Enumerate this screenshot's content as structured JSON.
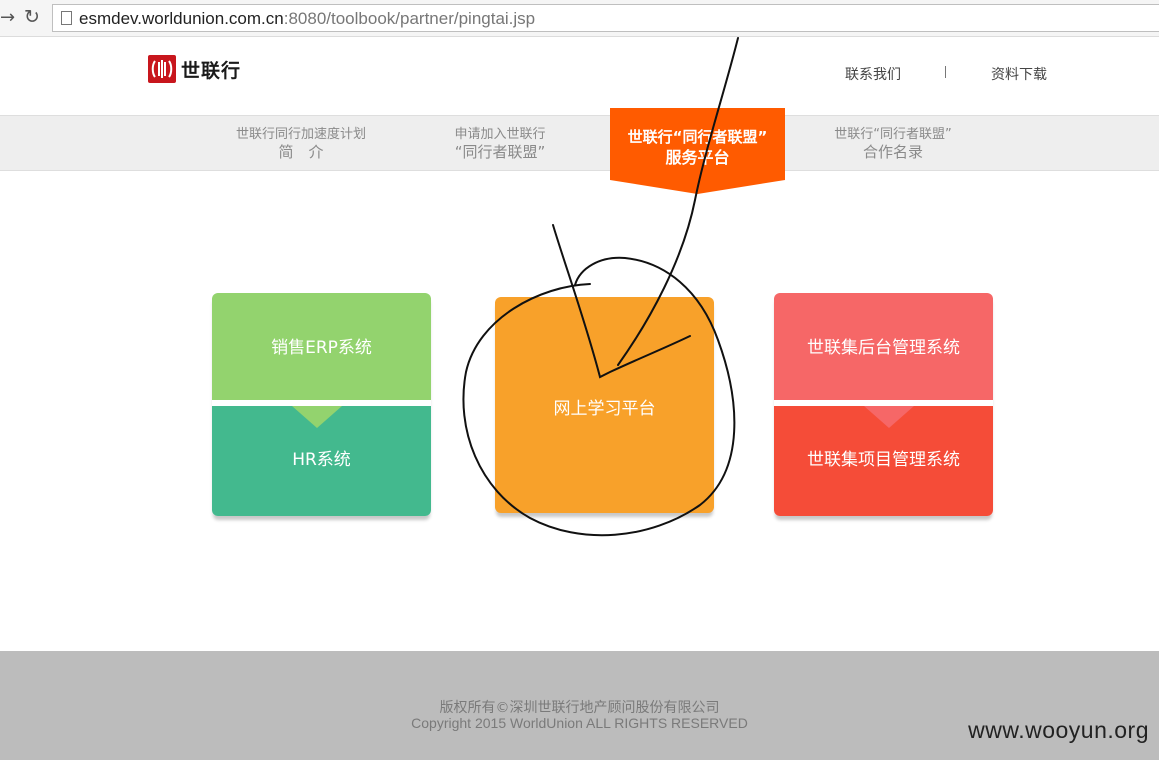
{
  "browser": {
    "url_host": "esmdev.worldunion.com.cn",
    "url_rest": ":8080/toolbook/partner/pingtai.jsp",
    "forward_icon": "forward-arrow-icon",
    "reload_icon": "reload-icon"
  },
  "header": {
    "logo_text": "世联行",
    "links": {
      "contact": "联系我们",
      "download": "资料下载"
    }
  },
  "nav": {
    "tabs": [
      {
        "line1": "世联行同行加速度计划",
        "line2": "简　介"
      },
      {
        "line1": "申请加入世联行",
        "line2": "“同行者联盟”"
      },
      {
        "line1": "世联行“同行者联盟”",
        "line2": "服务平台",
        "active": true
      },
      {
        "line1": "世联行“同行者联盟”",
        "line2": "合作名录"
      }
    ]
  },
  "cards": {
    "left_top": "销售ERP系统",
    "left_bottom": "HR系统",
    "center": "网上学习平台",
    "right_top": "世联集后台管理系统",
    "right_bottom": "世联集项目管理系统"
  },
  "footer": {
    "line_cn": "版权所有©深圳世联行地产顾问股份有限公司",
    "line_en": "Copyright 2015 WorldUnion ALL RIGHTS RESERVED",
    "watermark": "www.wooyun.org"
  },
  "colors": {
    "active_tab": "#ff5b00",
    "erp": "#93d36e",
    "hr": "#43b98e",
    "learning": "#f8a12a",
    "backend": "#f66767",
    "project": "#f54c38"
  }
}
